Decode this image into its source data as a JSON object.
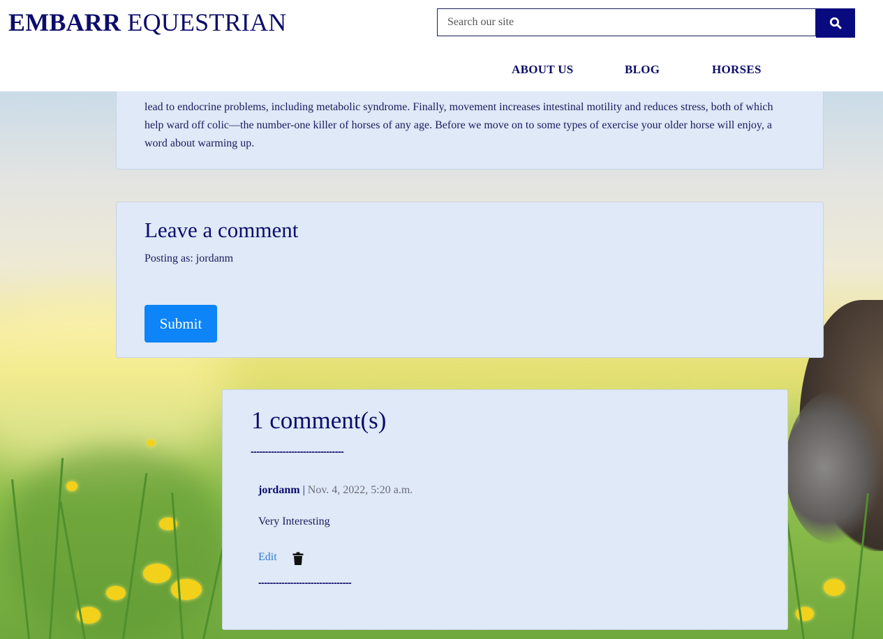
{
  "brand": {
    "name_bold": "EMBARR",
    "name_rest": "EQUESTRIAN"
  },
  "search": {
    "placeholder": "Search our site"
  },
  "nav": {
    "items": [
      "ABOUT US",
      "BLOG",
      "HORSES"
    ]
  },
  "article": {
    "text": "lead to endocrine problems, including metabolic syndrome. Finally, movement increases intestinal motility and reduces stress, both of which help ward off colic—the number-one killer of horses of any age. Before we move on to some types of exercise your older horse will enjoy, a word about warming up."
  },
  "comment_form": {
    "heading": "Leave a comment",
    "posting_as": "Posting as: jordanm",
    "submit_label": "Submit"
  },
  "comments": {
    "heading": "1 comment(s)",
    "divider": "--------------------------------",
    "items": [
      {
        "author": "jordanm",
        "separator": " | ",
        "date": "Nov. 4, 2022, 5:20 a.m.",
        "body": "Very Interesting",
        "edit_label": "Edit"
      }
    ]
  },
  "colors": {
    "brand_navy": "#0c0c6b",
    "search_button": "#0a0a80",
    "card_bg": "#dfe9f7",
    "submit_blue": "#0d84f7",
    "link_blue": "#2f7bd6"
  },
  "icons": {
    "search": "search-icon",
    "delete": "trash-icon"
  }
}
